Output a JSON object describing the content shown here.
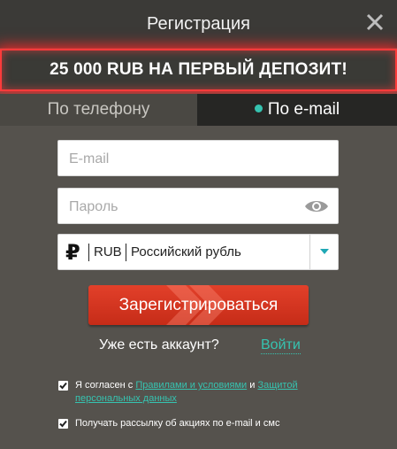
{
  "header": {
    "title": "Регистрация",
    "close_icon": "close-icon"
  },
  "promo": {
    "text": "25 000 RUB НА ПЕРВЫЙ ДЕПОЗИТ!"
  },
  "tabs": [
    {
      "label": "По телефону",
      "active": false
    },
    {
      "label": "По e-mail",
      "active": true
    }
  ],
  "form": {
    "email_placeholder": "E-mail",
    "email_value": "",
    "password_placeholder": "Пароль",
    "password_value": "",
    "currency": {
      "symbol": "₽",
      "code": "RUB",
      "name": "Российский рубль"
    },
    "submit_label": "Зарегистрироваться"
  },
  "account": {
    "question": "Уже есть аккаунт?",
    "login_label": "Войти"
  },
  "consents": {
    "terms_prefix": "Я согласен с ",
    "terms_link": "Правилами и условиями",
    "terms_mid": " и ",
    "privacy_link": "Защитой персональных данных",
    "newsletter": "Получать рассылку об акциях по e-mail и смс",
    "terms_checked": true,
    "newsletter_checked": true
  },
  "colors": {
    "accent": "#36c3b0",
    "promo_border": "#ff3b3b",
    "button": "#d6351f",
    "panel": "#55524d"
  }
}
